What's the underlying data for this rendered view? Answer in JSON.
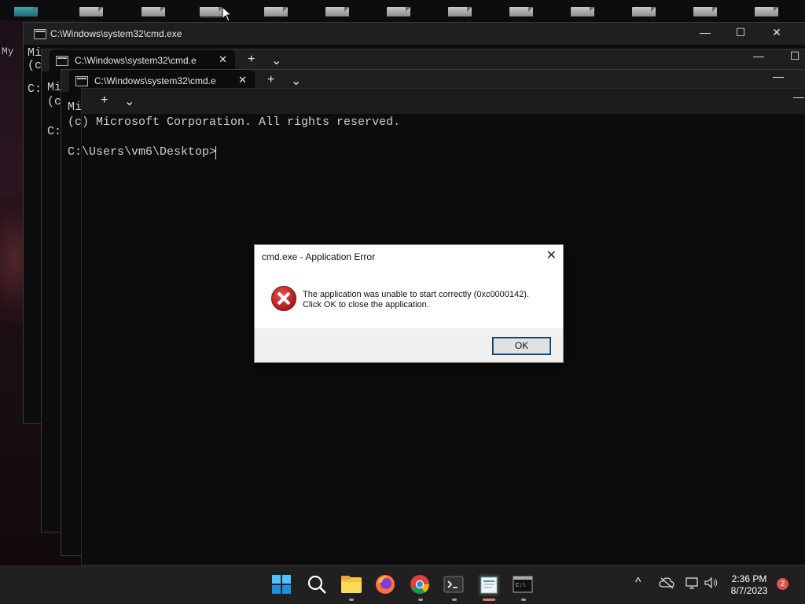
{
  "desktop": {
    "left_fragments": [
      "My",
      "Mi",
      "(c",
      "C:",
      "Mi",
      "(c",
      "C:"
    ]
  },
  "windows": [
    {
      "title": "C:\\Windows\\system32\\cmd.exe",
      "controls": {
        "minimize": "—",
        "maximize": "☐",
        "close": "✕"
      }
    },
    {
      "tab_title": "C:\\Windows\\system32\\cmd.e",
      "tab_close": "✕",
      "new_tab": "+",
      "dropdown": "⌄"
    },
    {
      "tab_title": "C:\\Windows\\system32\\cmd.e",
      "tab_close": "✕",
      "new_tab": "+",
      "dropdown": "⌄"
    },
    {
      "new_tab": "+",
      "dropdown": "⌄"
    }
  ],
  "console": {
    "line1": "Mi",
    "line2": "(c) Microsoft Corporation. All rights reserved.",
    "prompt": "C:\\Users\\vm6\\Desktop>"
  },
  "dialog": {
    "title": "cmd.exe - Application Error",
    "close": "✕",
    "message_line1": "The application was unable to start correctly (0xc0000142).",
    "message_line2": "Click OK to close the application.",
    "ok_label": "OK",
    "icon": "error-icon"
  },
  "taskbar": {
    "apps": [
      "start-icon",
      "search-icon",
      "file-explorer-icon",
      "firefox-icon",
      "chrome-icon",
      "terminal-icon",
      "notepad-icon",
      "cmd-icon"
    ],
    "tray_chevron": "^",
    "clock_time": "2:36 PM",
    "clock_date": "8/7/2023",
    "notification_count": "2"
  },
  "colors": {
    "accent_active": "#e07a5f",
    "error_red": "#c62828",
    "dialog_focus": "#0078d7"
  }
}
